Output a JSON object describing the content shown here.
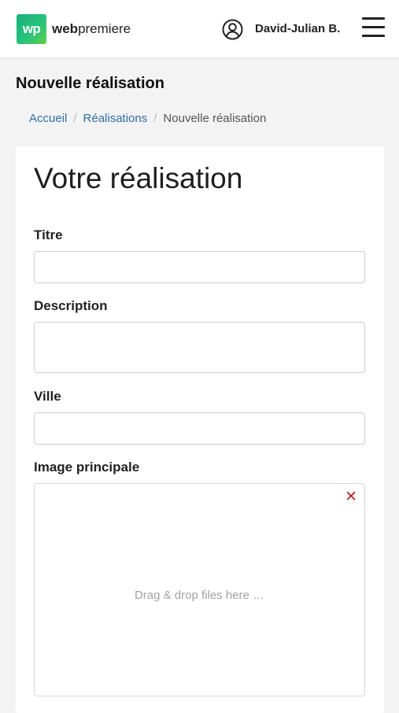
{
  "header": {
    "logo_mark": "wp",
    "logo_bold": "web",
    "logo_rest": "premiere",
    "user_name": "David-Julian B."
  },
  "page_title": "Nouvelle réalisation",
  "breadcrumb": {
    "home": "Accueil",
    "section": "Réalisations",
    "current": "Nouvelle réalisation",
    "separator": "/"
  },
  "form": {
    "title": "Votre réalisation",
    "fields": {
      "titre": {
        "label": "Titre",
        "value": ""
      },
      "description": {
        "label": "Description",
        "value": ""
      },
      "ville": {
        "label": "Ville",
        "value": ""
      }
    },
    "image": {
      "label": "Image principale",
      "dropzone_text": "Drag & drop files here …",
      "remove_symbol": "✕"
    }
  },
  "colors": {
    "link": "#2f6ea8",
    "logo_green": "#27c27c",
    "remove_red": "#b52a2a"
  }
}
